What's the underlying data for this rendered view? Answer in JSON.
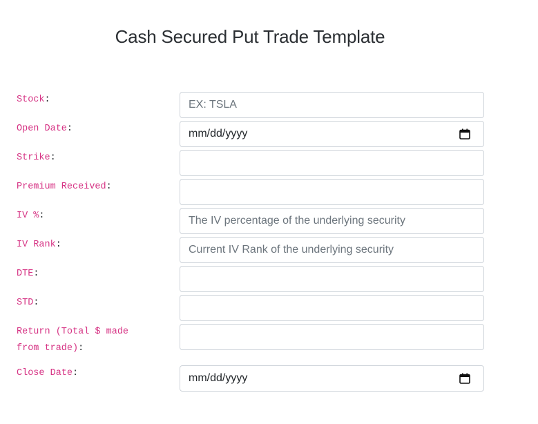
{
  "page": {
    "title": "Cash Secured Put Trade Template"
  },
  "fields": [
    {
      "id": "stock",
      "label_code": "Stock",
      "label_suffix": ":",
      "type": "text",
      "value": "",
      "placeholder": "EX: TSLA"
    },
    {
      "id": "open_date",
      "label_code": "Open Date",
      "label_suffix": ":",
      "type": "date",
      "value": "mm/dd/yyyy",
      "placeholder": ""
    },
    {
      "id": "strike",
      "label_code": "Strike",
      "label_suffix": ":",
      "type": "text",
      "value": "",
      "placeholder": ""
    },
    {
      "id": "premium_received",
      "label_code": "Premium Received",
      "label_suffix": ":",
      "type": "text",
      "value": "",
      "placeholder": ""
    },
    {
      "id": "iv_percent",
      "label_code": "IV %",
      "label_suffix": ":",
      "type": "text",
      "value": "",
      "placeholder": "The IV percentage of the underlying security"
    },
    {
      "id": "iv_rank",
      "label_code": "IV Rank",
      "label_suffix": ":",
      "type": "text",
      "value": "",
      "placeholder": "Current IV Rank of the underlying security"
    },
    {
      "id": "dte",
      "label_code": "DTE",
      "label_suffix": ":",
      "type": "text",
      "value": "",
      "placeholder": ""
    },
    {
      "id": "std",
      "label_code": "STD",
      "label_suffix": ":",
      "type": "text",
      "value": "",
      "placeholder": ""
    },
    {
      "id": "return",
      "label_code_line1": "Return (Total $ made",
      "label_code_line2": "from trade)",
      "label_suffix": ":",
      "type": "text",
      "value": "",
      "placeholder": ""
    },
    {
      "id": "close_date",
      "label_code": "Close Date",
      "label_suffix": ":",
      "type": "date",
      "value": "mm/dd/yyyy",
      "placeholder": ""
    }
  ],
  "icons": {
    "date_picker": "calendar-icon"
  },
  "colors": {
    "label_code": "#d63384",
    "input_border": "#ced4da",
    "placeholder": "#6c757d",
    "title": "#2b2f33"
  }
}
